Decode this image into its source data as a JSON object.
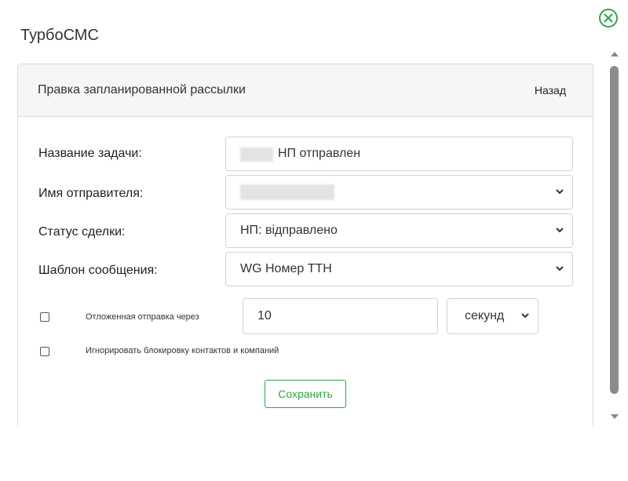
{
  "app": {
    "title": "ТурбоСМС"
  },
  "card": {
    "title": "Правка запланированной рассылки",
    "back_label": "Назад"
  },
  "form": {
    "task_name": {
      "label": "Название задачи:",
      "value": "НП отправлен"
    },
    "sender_name": {
      "label": "Имя отправителя:",
      "value": ""
    },
    "deal_status": {
      "label": "Статус сделки:",
      "value": "НП: відправлено"
    },
    "message_template": {
      "label": "Шаблон сообщения:",
      "value": "WG Номер ТТН"
    },
    "delayed_send": {
      "label": "Отложенная отправка через",
      "checked": false,
      "amount": "10",
      "unit": "секунд"
    },
    "ignore_block": {
      "label": "Игнорировать блокировку контактов и компаний",
      "checked": false
    },
    "save_label": "Сохранить"
  },
  "colors": {
    "accent_green": "#28a745",
    "border": "#ced4da",
    "header_bg": "#f6f6f6"
  },
  "icons": {
    "close": "close-circle-icon",
    "select": "chevron-down-icon"
  }
}
